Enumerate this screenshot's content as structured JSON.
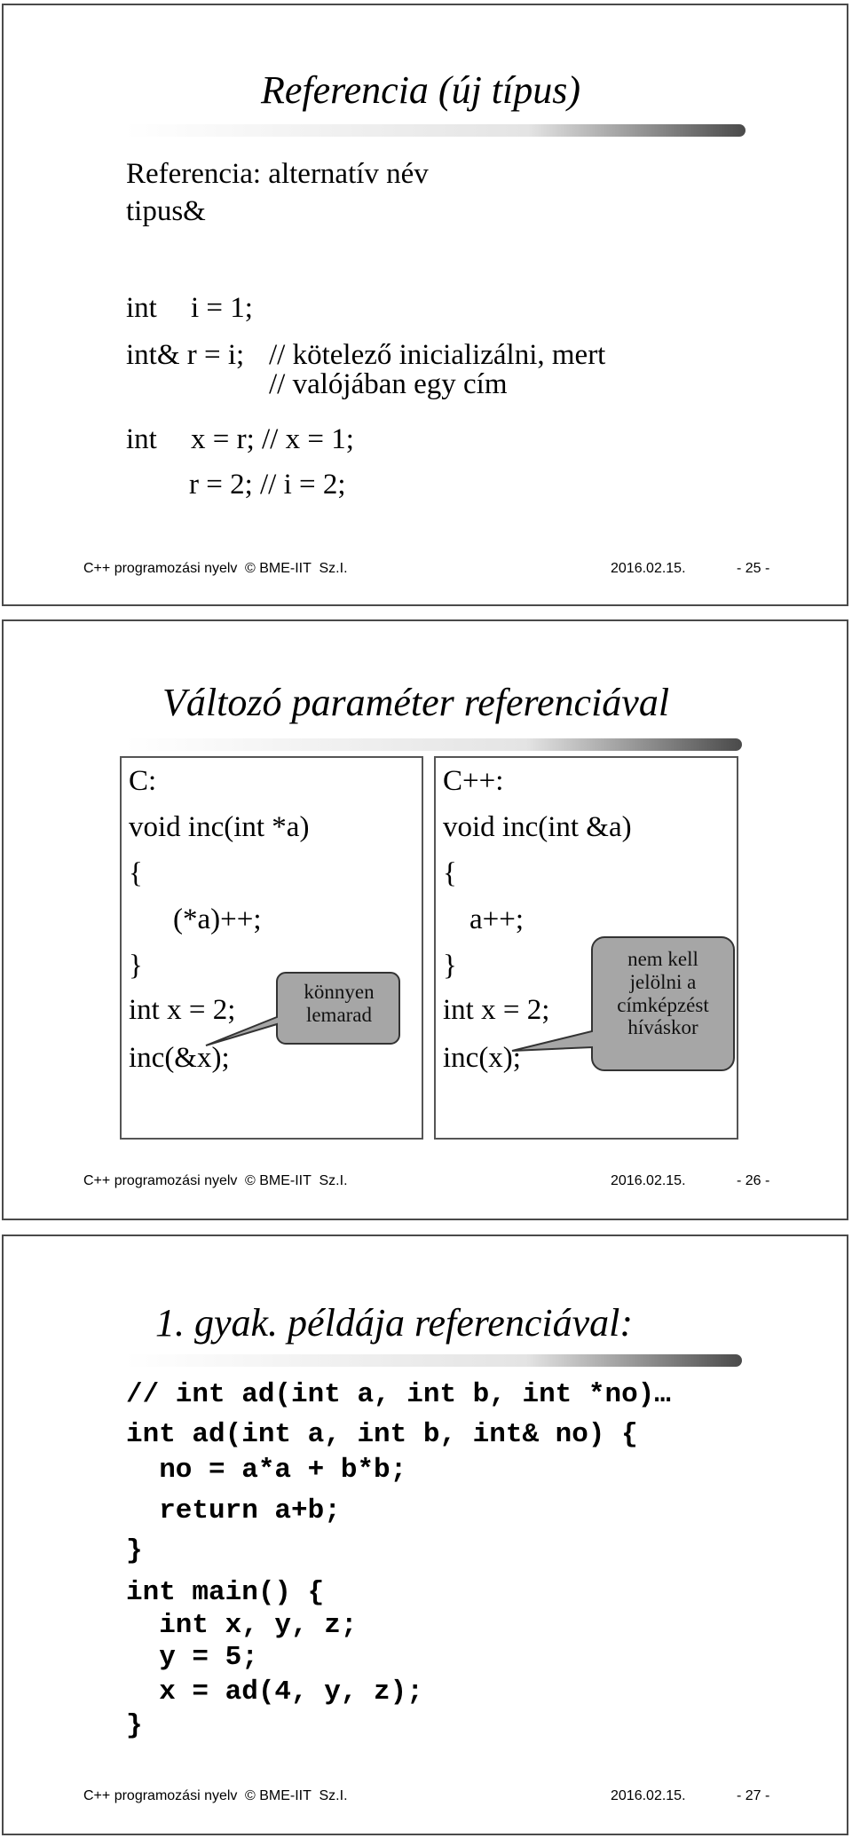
{
  "footer": {
    "course": "C++ programozási nyelv",
    "copyright": "© BME-IIT  Sz.I.",
    "date": "2016.02.15."
  },
  "slides": [
    {
      "page": "- 25 -",
      "title": "Referencia (új típus)",
      "lines": {
        "def": "Referencia: alternatív név",
        "type": "tipus&",
        "l1a": "int",
        "l1b": "i = 1;",
        "l2a": "int& r = i;",
        "l2b": "// kötelező inicializálni, mert",
        "l3": "// valójában egy cím",
        "l4a": "int",
        "l4b": "x = r; // x = 1;",
        "l5": "r = 2; // i = 2;"
      }
    },
    {
      "page": "- 26 -",
      "title": "Változó paraméter referenciával",
      "left": {
        "lines": [
          "C:",
          "void inc(int *a)",
          "{",
          "(*a)++;",
          "}",
          "int x = 2;",
          "inc(&x);"
        ],
        "callout": [
          "könnyen",
          "lemarad"
        ]
      },
      "right": {
        "lines": [
          "C++:",
          "void inc(int &a)",
          "{",
          "a++;",
          "}",
          "int x = 2;",
          "inc(x);"
        ],
        "callout": [
          "nem kell",
          "jelölni a",
          "címképzést",
          "híváskor"
        ]
      },
      "callout_fill": "#a6a6a6"
    },
    {
      "page": "- 27 -",
      "title": "1. gyak. példája referenciával:",
      "code": [
        "// int ad(int a, int b, int *no)…",
        "int ad(int a, int b, int& no) {",
        "  no = a*a + b*b;",
        "  return a+b;",
        "}",
        "int main() {",
        "  int x, y, z;",
        "  y = 5;",
        "  x = ad(4, y, z);",
        "}"
      ]
    }
  ]
}
